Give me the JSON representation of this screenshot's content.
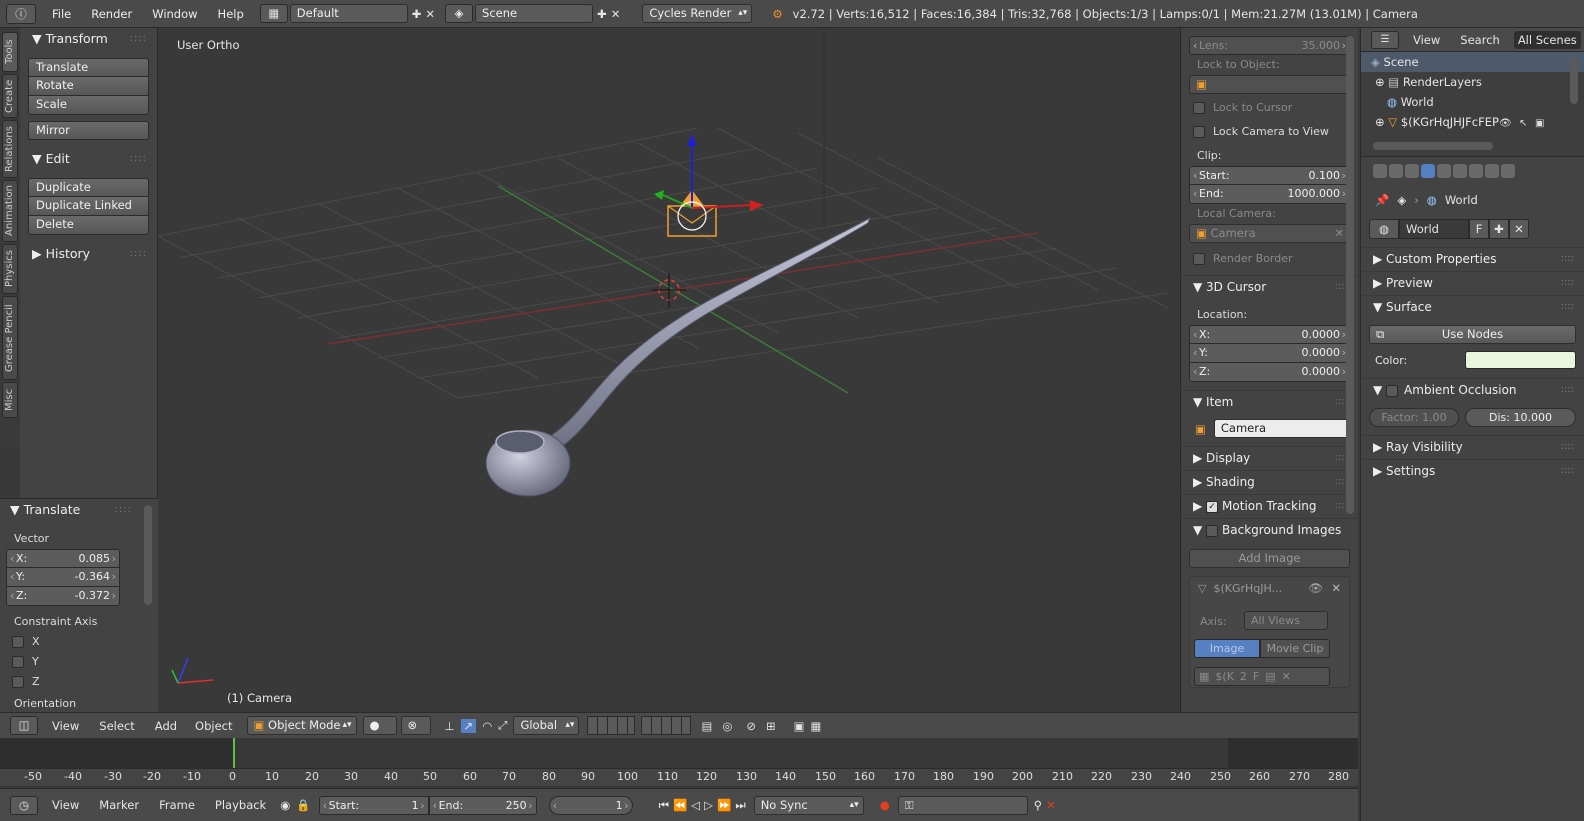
{
  "topbar": {
    "menus": [
      "File",
      "Render",
      "Window",
      "Help"
    ],
    "layout": "Default",
    "scene": "Scene",
    "engine": "Cycles Render",
    "stats": "v2.72 | Verts:16,512 | Faces:16,384 | Tris:32,768 | Objects:1/3 | Lamps:0/1 | Mem:21.27M (13.01M) | Camera"
  },
  "tabs": [
    "Tools",
    "Create",
    "Relations",
    "Animation",
    "Physics",
    "Grease Pencil",
    "Misc"
  ],
  "tools": {
    "transform": {
      "title": "Transform",
      "buttons": [
        "Translate",
        "Rotate",
        "Scale",
        "Mirror"
      ]
    },
    "edit": {
      "title": "Edit",
      "buttons": [
        "Duplicate",
        "Duplicate Linked",
        "Delete"
      ]
    },
    "history": {
      "title": "History"
    }
  },
  "operator": {
    "title": "Translate",
    "vector_label": "Vector",
    "x_label": "X:",
    "x": "0.085",
    "y_label": "Y:",
    "y": "-0.364",
    "z_label": "Z:",
    "z": "-0.372",
    "constraint_label": "Constraint Axis",
    "axes": [
      "X",
      "Y",
      "Z"
    ],
    "orientation_label": "Orientation"
  },
  "viewport": {
    "view_name": "User Ortho",
    "object_label": "(1) Camera"
  },
  "npanel": {
    "lens_label": "Lens:",
    "lens": "35.000",
    "lock_object": "Lock to Object:",
    "lock_cursor": "Lock to Cursor",
    "lock_camera": "Lock Camera to View",
    "clip": "Clip:",
    "clip_start_label": "Start:",
    "clip_start": "0.100",
    "clip_end_label": "End:",
    "clip_end": "1000.000",
    "local_camera": "Local Camera:",
    "camera_placeholder": "Camera",
    "render_border": "Render Border",
    "cursor_title": "3D Cursor",
    "location": "Location:",
    "cx_label": "X:",
    "cx": "0.0000",
    "cy_label": "Y:",
    "cy": "0.0000",
    "cz_label": "Z:",
    "cz": "0.0000",
    "item_title": "Item",
    "item_name": "Camera",
    "display": "Display",
    "shading": "Shading",
    "motion_tracking": "Motion Tracking",
    "bg_images": "Background Images",
    "add_image": "Add Image",
    "bg_name": "$(KGrHqJH...",
    "axis_label": "Axis:",
    "axis_value": "All Views",
    "tab_image": "Image",
    "tab_movie": "Movie Clip",
    "img_field": "$(K",
    "img_users": "2",
    "img_fake": "F"
  },
  "outliner": {
    "menus": [
      "View",
      "Search"
    ],
    "filter": "All Scenes",
    "items": [
      "Scene",
      "RenderLayers",
      "World",
      "$(KGrHqJHJFcFEP"
    ]
  },
  "props": {
    "breadcrumb": "World",
    "world_name": "World",
    "fake_user": "F",
    "sections": [
      "Custom Properties",
      "Preview",
      "Surface"
    ],
    "use_nodes": "Use Nodes",
    "color_label": "Color:",
    "world_color": "#e9f5dc",
    "ao_title": "Ambient Occlusion",
    "factor": "Factor: 1.00",
    "distance": "Dis: 10.000",
    "ray_visibility": "Ray Visibility",
    "settings": "Settings"
  },
  "header3d": {
    "menus": [
      "View",
      "Select",
      "Add",
      "Object"
    ],
    "mode": "Object Mode",
    "orientation": "Global"
  },
  "timeline": {
    "ticks": [
      "-50",
      "-40",
      "-30",
      "-20",
      "-10",
      "0",
      "10",
      "20",
      "30",
      "40",
      "50",
      "60",
      "70",
      "80",
      "90",
      "100",
      "110",
      "120",
      "130",
      "140",
      "150",
      "160",
      "170",
      "180",
      "190",
      "200",
      "210",
      "220",
      "230",
      "240",
      "250",
      "260",
      "270",
      "280"
    ],
    "menus": [
      "View",
      "Marker",
      "Frame",
      "Playback"
    ],
    "start_label": "Start:",
    "start": "1",
    "end_label": "End:",
    "end": "250",
    "current": "1",
    "sync": "No Sync"
  },
  "colors": {
    "accent": "#5680c2",
    "selected_orange": "#f0a030",
    "grid_red": "#8a3030",
    "grid_green": "#3a7a3a"
  }
}
